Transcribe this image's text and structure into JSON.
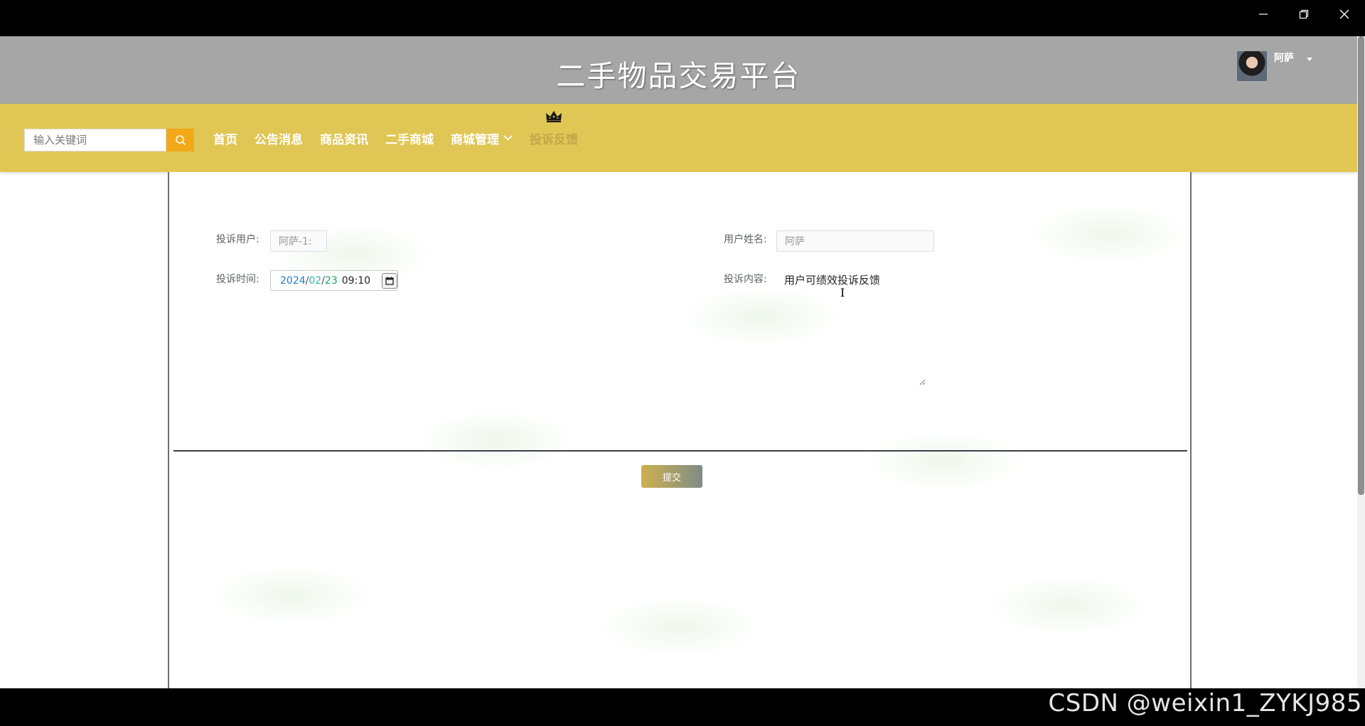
{
  "window": {
    "minimize_icon": "minimize-icon",
    "maximize_icon": "restore-icon",
    "close_icon": "close-icon"
  },
  "header": {
    "site_title": "二手物品交易平台",
    "user_name": "阿萨"
  },
  "nav": {
    "search_placeholder": "输入关键词",
    "items": [
      {
        "label": "首页"
      },
      {
        "label": "公告消息"
      },
      {
        "label": "商品资讯"
      },
      {
        "label": "二手商城"
      },
      {
        "label": "商城管理"
      },
      {
        "label": "投诉反馈",
        "active": true
      }
    ],
    "accent": "#e0c654",
    "search_button_color": "#f3a817"
  },
  "form": {
    "complaint_user_label": "投诉用户:",
    "complaint_user_value": "阿萨-1:",
    "user_name_label": "用户姓名:",
    "user_name_value": "阿萨",
    "complaint_time_label": "投诉时间:",
    "date": {
      "year": "2024",
      "month": "02",
      "day": "23",
      "time": "09:10"
    },
    "complaint_content_label": "投诉内容:",
    "complaint_content_value": "用户可绩效投诉反馈",
    "submit_label": "提交"
  },
  "watermark": "CSDN @weixin1_ZYKJ985"
}
